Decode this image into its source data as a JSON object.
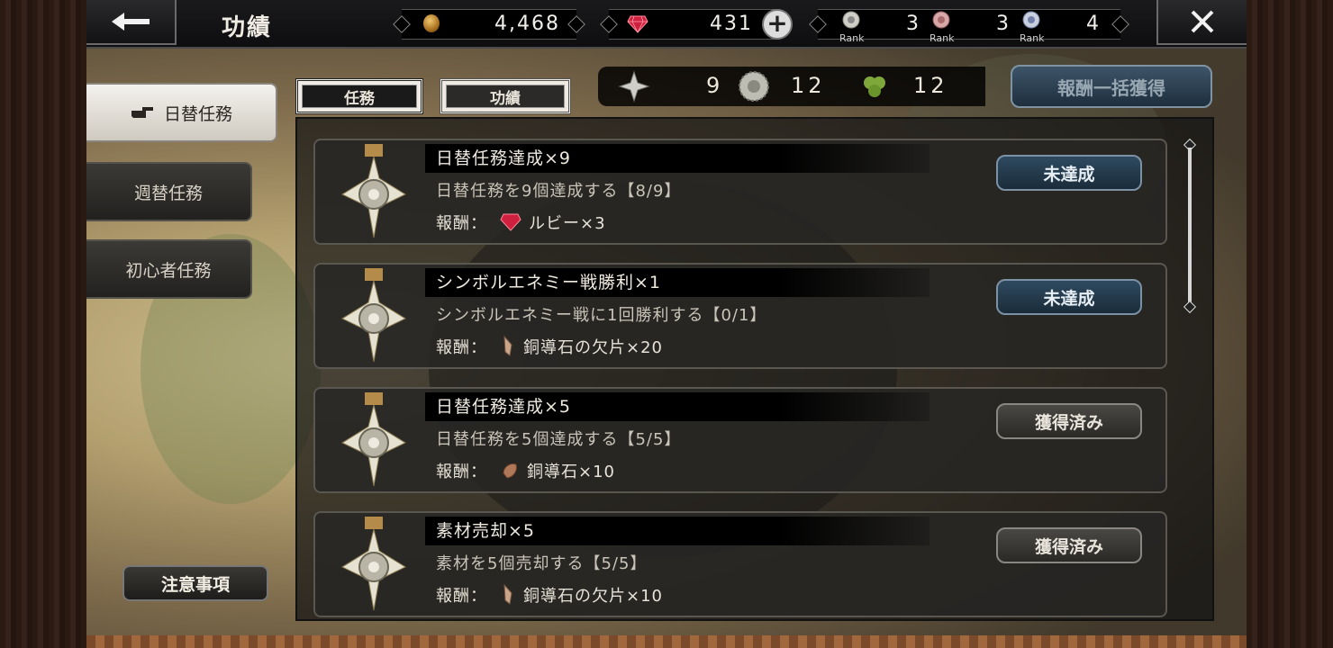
{
  "header": {
    "title": "功績",
    "gold": "4,468",
    "ruby": "431",
    "ranks": [
      {
        "label": "Rank",
        "value": "3"
      },
      {
        "label": "Rank",
        "value": "3"
      },
      {
        "label": "Rank",
        "value": "4"
      }
    ]
  },
  "sidebar": {
    "tabs": [
      {
        "label": "日替任務",
        "active": true
      },
      {
        "label": "週替任務",
        "active": false
      },
      {
        "label": "初心者任務",
        "active": false
      }
    ],
    "notice_label": "注意事項"
  },
  "main": {
    "tabs": [
      {
        "label": "任務",
        "active": true
      },
      {
        "label": "功績",
        "active": false
      }
    ],
    "reward_counts": {
      "star": "9",
      "medal": "12",
      "clover": "12"
    },
    "claim_all_label": "報酬一括獲得",
    "missions": [
      {
        "title": "日替任務達成×9",
        "desc": "日替任務を9個達成する【8/9】",
        "reward_prefix": "報酬：",
        "reward_icon": "ruby-icon",
        "reward": "ルビー×3",
        "status": "未達成",
        "state": "pending"
      },
      {
        "title": "シンボルエネミー戦勝利×1",
        "desc": "シンボルエネミー戦に1回勝利する【0/1】",
        "reward_prefix": "報酬：",
        "reward_icon": "copper-shard-icon",
        "reward": "銅導石の欠片×20",
        "status": "未達成",
        "state": "pending"
      },
      {
        "title": "日替任務達成×5",
        "desc": "日替任務を5個達成する【5/5】",
        "reward_prefix": "報酬：",
        "reward_icon": "copper-stone-icon",
        "reward": "銅導石×10",
        "status": "獲得済み",
        "state": "done"
      },
      {
        "title": "素材売却×5",
        "desc": "素材を5個売却する【5/5】",
        "reward_prefix": "報酬：",
        "reward_icon": "copper-shard-icon",
        "reward": "銅導石の欠片×10",
        "status": "獲得済み",
        "state": "done"
      }
    ]
  },
  "colors": {
    "pending_button": "#2f4a60",
    "done_button": "#4a4844",
    "ruby": "#d02040"
  }
}
